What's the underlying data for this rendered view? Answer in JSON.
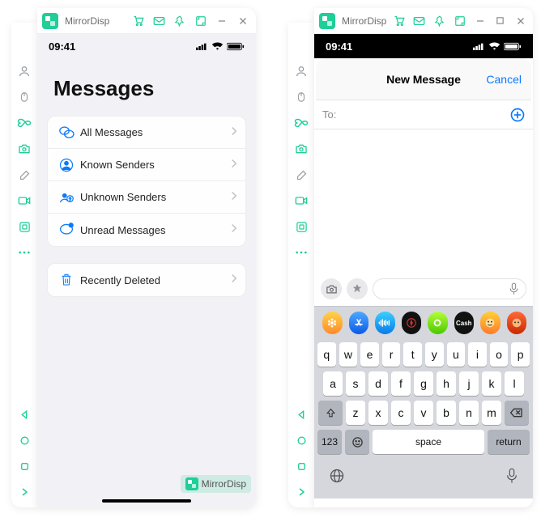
{
  "titlebar": {
    "appname": "MirrorDisp"
  },
  "statusbar": {
    "time": "09:41"
  },
  "left": {
    "title": "Messages",
    "filters": [
      {
        "label": "All Messages"
      },
      {
        "label": "Known Senders"
      },
      {
        "label": "Unknown Senders"
      },
      {
        "label": "Unread Messages"
      }
    ],
    "recentlyDeleted": "Recently Deleted"
  },
  "right": {
    "headerCancel": "Cancel",
    "headerTitle": "New Message",
    "toLabel": "To:",
    "keyboard": {
      "row1": [
        "q",
        "w",
        "e",
        "r",
        "t",
        "y",
        "u",
        "i",
        "o",
        "p"
      ],
      "row2": [
        "a",
        "s",
        "d",
        "f",
        "g",
        "h",
        "j",
        "k",
        "l"
      ],
      "row3": [
        "z",
        "x",
        "c",
        "v",
        "b",
        "n",
        "m"
      ],
      "space": "space",
      "return": "return",
      "num": "123"
    },
    "appRow": [
      "photos",
      "appstore",
      "music",
      "find",
      "fitness",
      "cash",
      "memoji",
      "sticker"
    ]
  },
  "watermark": {
    "label": "MirrorDisp"
  }
}
